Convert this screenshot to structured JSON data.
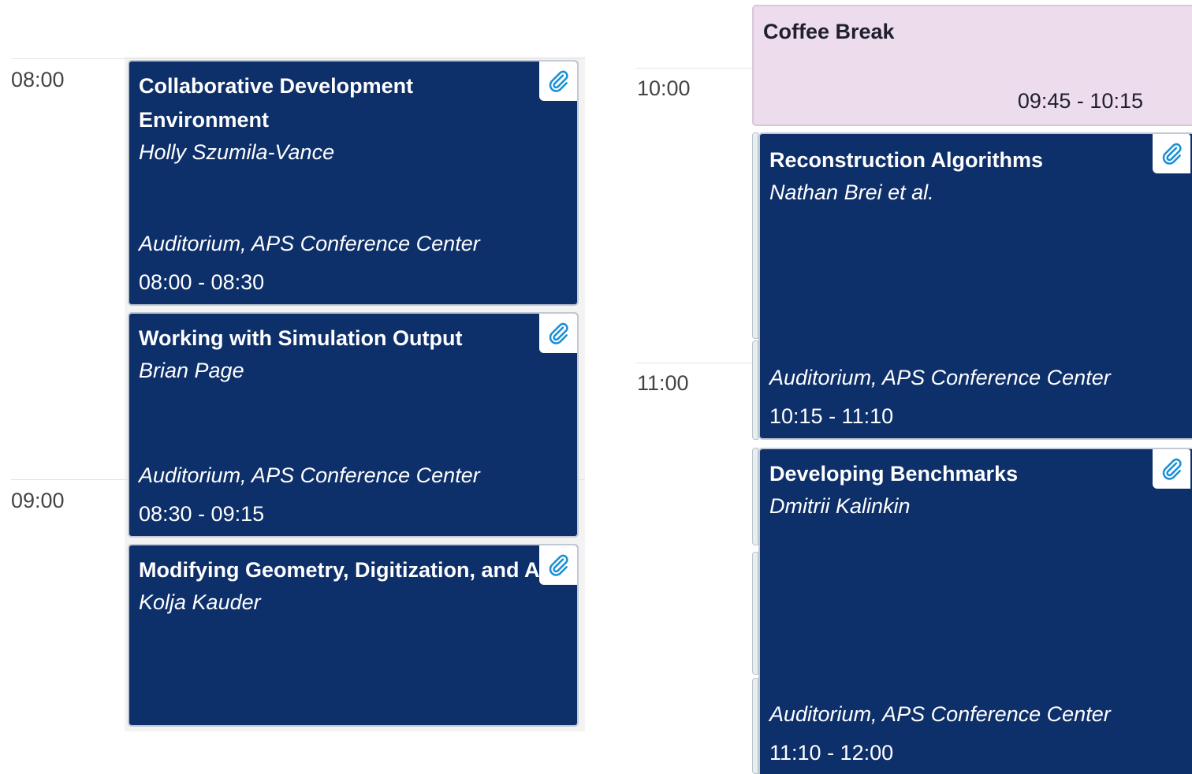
{
  "time_labels": [
    "08:00",
    "09:00",
    "10:00",
    "11:00"
  ],
  "events": [
    {
      "title": "Collaborative Development Environment",
      "speaker": "Holly Szumila-Vance",
      "location": "Auditorium, APS Conference Center",
      "time": "08:00 - 08:30",
      "has_attachment": true
    },
    {
      "title": "Working with Simulation Output",
      "speaker": "Brian Page",
      "location": "Auditorium, APS Conference Center",
      "time": "08:30 - 09:15",
      "has_attachment": true
    },
    {
      "title": "Modifying Geometry, Digitization, and Anything Else",
      "speaker": "Kolja Kauder",
      "has_attachment": true
    },
    {
      "title": "Coffee Break",
      "time": "09:45 - 10:15"
    },
    {
      "title": "Reconstruction Algorithms",
      "speaker": "Nathan Brei et al.",
      "location": "Auditorium, APS Conference Center",
      "time": "10:15 - 11:10",
      "has_attachment": true
    },
    {
      "title": "Developing Benchmarks",
      "speaker": "Dmitrii Kalinkin",
      "location": "Auditorium, APS Conference Center",
      "time": "11:10 - 12:00",
      "has_attachment": true
    }
  ],
  "icons": {
    "attachment": "paperclip-icon"
  },
  "colors": {
    "event_bg": "#0d2f6a",
    "break_bg": "#ecdcec",
    "attachment_icon": "#1a8fd6"
  }
}
